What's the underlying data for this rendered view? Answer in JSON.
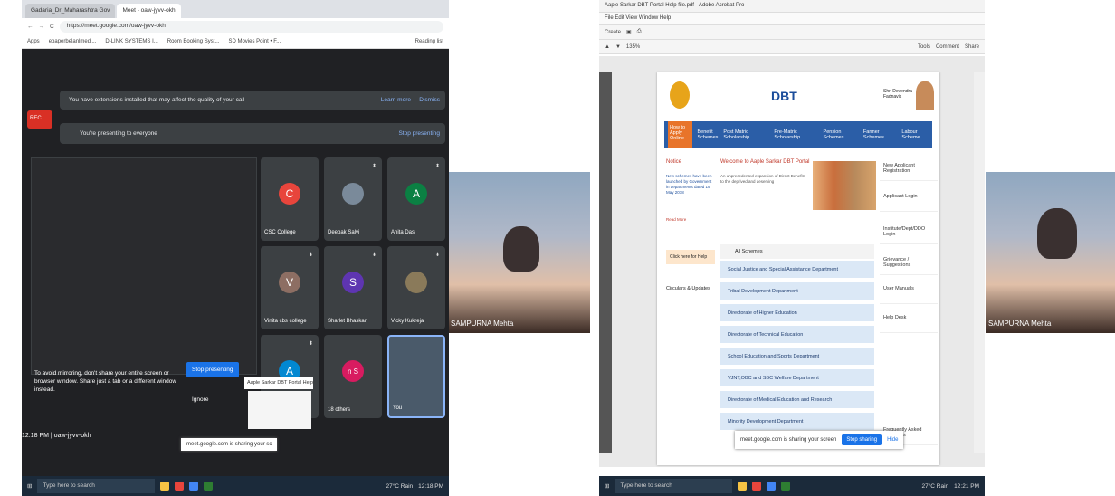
{
  "left_screen": {
    "tabs": [
      "Gadaria_Dr_Maharashtra Gov",
      "Meet - oaw-jyvv-okh"
    ],
    "url": "https://meet.google.com/oaw-jyvv-okh",
    "bookmarks": [
      "Apps",
      "epaperbelanlmedi...",
      "D-LINK SYSTEMS I...",
      "Room Booking Syst...",
      "SD Movies Point • F..."
    ],
    "reading_list": "Reading list",
    "rec_label": "REC",
    "extension_banner": "You have extensions installed that may affect the quality of your call",
    "learn_more": "Learn more",
    "dismiss": "Dismiss",
    "presenting_banner": "You're presenting to everyone",
    "stop_presenting_top": "Stop presenting",
    "participants": [
      {
        "initial": "C",
        "name": "CSC College",
        "color": "#e8453c"
      },
      {
        "initial": "",
        "name": "Deepak Salvi",
        "color": "#7a8a9a"
      },
      {
        "initial": "A",
        "name": "Anita Das",
        "color": "#0b8043"
      },
      {
        "initial": "V",
        "name": "Vinita cbs college",
        "color": "#8d6e63"
      },
      {
        "initial": "S",
        "name": "Sharlet Bhaskar",
        "color": "#5e35b1"
      },
      {
        "initial": "",
        "name": "Vicky Kukreja",
        "color": "#8a7a5a"
      },
      {
        "initial": "A",
        "name": "",
        "color": "#0288d1"
      },
      {
        "initial": "n S",
        "name": "18 others",
        "color": "#d81b60"
      },
      {
        "initial": "",
        "name": "You",
        "color": "#4a5a6a"
      }
    ],
    "mirror_warning": "To avoid mirroring, don't share your entire screen or browser window. Share just a tab or a different window instead.",
    "stop_presenting": "Stop presenting",
    "ignore": "Ignore",
    "shared_tab": "Aaple Sarkar DBT Portal Help N...",
    "sharing_notice": "meet.google.com is sharing your sc",
    "time_meeting": "12:18 PM | oaw-jyvv-okh",
    "search_placeholder": "Type here to search",
    "weather": "27°C Rain",
    "clock": "12:18 PM"
  },
  "video_left": {
    "name": "SAMPURNA Mehta"
  },
  "right_screen": {
    "title": "Aaple Sarkar DBT Portal Help file.pdf - Adobe Acrobat Pro",
    "menu": "File  Edit  View  Window  Help",
    "create": "Create",
    "zoom": "135%",
    "tools": [
      "Tools",
      "Comment",
      "Share"
    ],
    "logo_text": "DBT",
    "leader": "Shri Devendra Fadnavis",
    "nav_how": "How to Apply Online",
    "nav_benefit": "Benefit Schemes",
    "nav_items": [
      "Post Matric Scholarship",
      "Pre-Matric Scholarship",
      "Pension Schemes",
      "Farmer Schemes",
      "Labour Scheme"
    ],
    "notice": "Notice",
    "notice_text": "New schemes have been launched by Government in departments dated 19 May 2018",
    "read_more": "Read More",
    "welcome": "Welcome to Aaple Sarkar DBT Portal",
    "welcome_sub": "An unprecedented expansion of Direct Benefits to the deprived and deserving",
    "click_help": "Click here for Help",
    "circulars": "Circulars & Updates",
    "all_schemes": "All Schemes",
    "departments": [
      "Social Justice and Special Assistance Department",
      "Tribal Development Department",
      "Directorate of Higher Education",
      "Directorate of Technical Education",
      "School Education and Sports Department",
      "VJNT,OBC and SBC Welfare Department",
      "Directorate of Medical Education and Research",
      "Minority Development Department"
    ],
    "right_links": [
      "New Applicant Registration",
      "Applicant Login",
      "Institute/Dept/DDO Login",
      "Grievance / Suggestions",
      "User Manuals",
      "Help Desk",
      "Frequently Asked Questions"
    ],
    "sharing_notice": "meet.google.com is sharing your screen",
    "stop_sharing": "Stop sharing",
    "hide": "Hide",
    "search_placeholder": "Type here to search",
    "weather": "27°C Rain",
    "clock": "12:21 PM"
  },
  "video_right": {
    "name": "SAMPURNA Mehta"
  }
}
